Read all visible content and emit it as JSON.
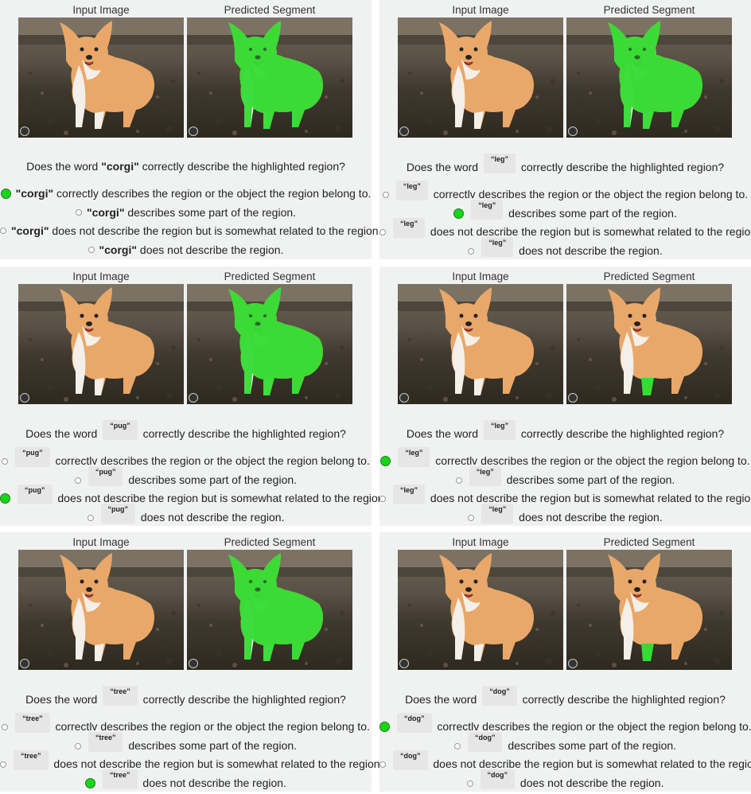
{
  "headers": {
    "input": "Input Image",
    "predicted": "Predicted Segment"
  },
  "question": {
    "prefix": "Does the word",
    "suffix": "correctly describe the highlighted region?"
  },
  "options": {
    "a": "correctly describes the region or the object the region belong to.",
    "b": "describes some part of the region.",
    "c": "does not describe the region but is somewhat related to the region.",
    "d": "does not describe the region."
  },
  "options_variant": {
    "a": "correctlv describes the region or the object the region belong to."
  },
  "panels": [
    {
      "word": "\"corgi\"",
      "segment": "body",
      "selected": "a"
    },
    {
      "word": "“leg”",
      "segment": "body",
      "selected": "b"
    },
    {
      "word": "“pug”",
      "segment": "body",
      "selected": "c"
    },
    {
      "word": "“leg”",
      "segment": "leg",
      "selected": "a"
    },
    {
      "word": "“tree”",
      "segment": "body",
      "selected": "d"
    },
    {
      "word": "“dog”",
      "segment": "leg",
      "selected": "a"
    }
  ],
  "colors": {
    "highlight": "#33dd33",
    "radio_selected": "#19d419"
  }
}
